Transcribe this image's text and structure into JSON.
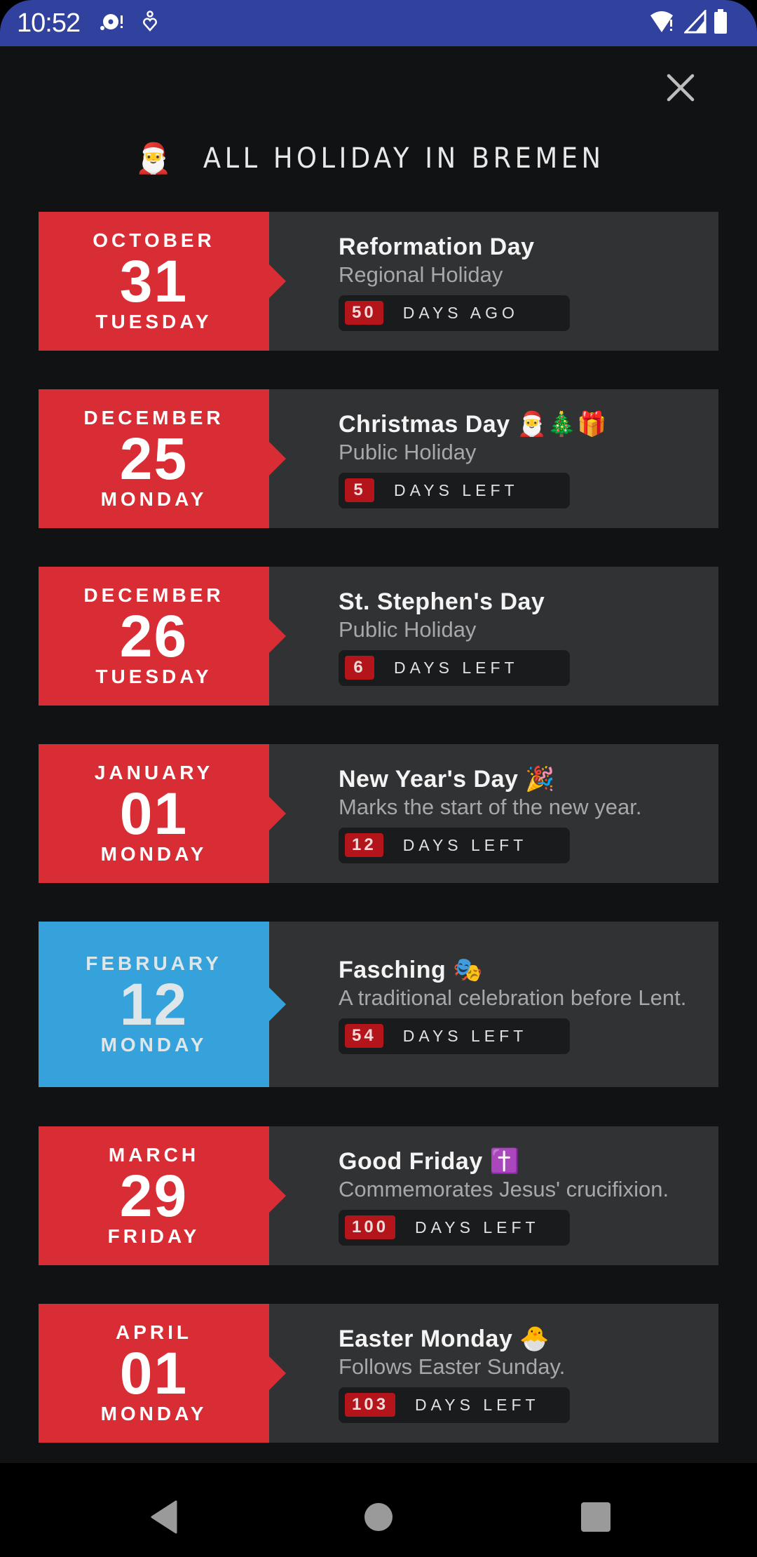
{
  "status_bar": {
    "time": "10:52",
    "left_icons": [
      "media-disc-alert-icon",
      "accessibility-icon"
    ],
    "right_icons": [
      "wifi-alert-icon",
      "signal-icon",
      "battery-icon"
    ]
  },
  "header": {
    "emoji": "🎅",
    "title": "ALL HOLIDAY IN BREMEN",
    "close_icon": "close-icon"
  },
  "colors": {
    "accent_red": "#d92d35",
    "accent_blue": "#35a2db",
    "badge_red": "#b3151b",
    "card_bg": "#313234",
    "screen_bg": "#111214",
    "status_bar": "#31419e"
  },
  "holidays": [
    {
      "month": "OCTOBER",
      "day": "31",
      "weekday": "TUESDAY",
      "name": "Reformation Day",
      "description": "Regional Holiday",
      "count": "50",
      "count_label": "DAYS AGO",
      "accent": "red"
    },
    {
      "month": "DECEMBER",
      "day": "25",
      "weekday": "MONDAY",
      "name": "Christmas Day 🎅🎄🎁",
      "description": "Public Holiday",
      "count": "5",
      "count_label": "DAYS LEFT",
      "accent": "red"
    },
    {
      "month": "DECEMBER",
      "day": "26",
      "weekday": "TUESDAY",
      "name": "St. Stephen's Day",
      "description": "Public Holiday",
      "count": "6",
      "count_label": "DAYS LEFT",
      "accent": "red"
    },
    {
      "month": "JANUARY",
      "day": "01",
      "weekday": "MONDAY",
      "name": "New Year's Day 🎉",
      "description": "Marks the start of the new year.",
      "count": "12",
      "count_label": "DAYS LEFT",
      "accent": "red"
    },
    {
      "month": "FEBRUARY",
      "day": "12",
      "weekday": "MONDAY",
      "name": "Fasching 🎭",
      "description": "A traditional celebration before Lent.",
      "count": "54",
      "count_label": "DAYS LEFT",
      "accent": "blue"
    },
    {
      "month": "MARCH",
      "day": "29",
      "weekday": "FRIDAY",
      "name": "Good Friday ✝️",
      "description": "Commemorates Jesus' crucifixion.",
      "count": "100",
      "count_label": "DAYS LEFT",
      "accent": "red"
    },
    {
      "month": "APRIL",
      "day": "01",
      "weekday": "MONDAY",
      "name": "Easter Monday 🐣",
      "description": "Follows Easter Sunday.",
      "count": "103",
      "count_label": "DAYS LEFT",
      "accent": "red"
    }
  ],
  "nav_bar": {
    "buttons": [
      "back-button",
      "home-button",
      "recents-button"
    ]
  }
}
